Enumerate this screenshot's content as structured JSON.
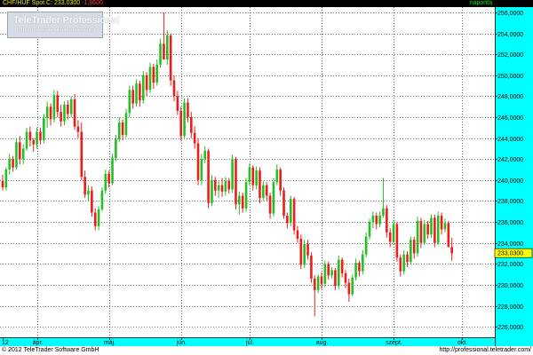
{
  "header": {
    "symbol": "CHF/HUF Spot",
    "close_label": "C:",
    "close_value": "233,0300",
    "change": "-1,8600",
    "frequency": "naponta"
  },
  "watermark": {
    "brand": "TeleTrader Professional",
    "url": "http://professional.teletrader.com/"
  },
  "footer": {
    "copyright": "© 2012 TeleTrader Software GmbH",
    "url": "http://professional.teletrader.com/"
  },
  "colors": {
    "up": "#22c022",
    "down": "#ee1c1c",
    "grid": "#000000",
    "axis_bg": "#00ffff",
    "plot_bg": "#ffffff",
    "header_bg": "#000000",
    "marker_bg": "#ffff00"
  },
  "chart_data": {
    "type": "candlestick",
    "y_ticks": [
      "226,0000",
      "228,0000",
      "230,0000",
      "232,0000",
      "234,0000",
      "236,0000",
      "238,0000",
      "240,0000",
      "242,0000",
      "244,0000",
      "246,0000",
      "248,0000",
      "250,0000",
      "252,0000",
      "254,0000",
      "256,0000"
    ],
    "ylim": [
      225,
      256.5
    ],
    "x_labels": [
      {
        "label": "12",
        "index": 0
      },
      {
        "label": "ápr.",
        "index": 10
      },
      {
        "label": "máj.",
        "index": 31
      },
      {
        "label": "jún.",
        "index": 52
      },
      {
        "label": "júl.",
        "index": 72
      },
      {
        "label": "aug.",
        "index": 93
      },
      {
        "label": "szept.",
        "index": 114
      },
      {
        "label": "okt.",
        "index": 134
      }
    ],
    "current_value_marker": "233,0300",
    "series": [
      {
        "name": "CHF/HUF Spot",
        "candles": [
          [
            239.9,
            240.5,
            239.0,
            239.3
          ],
          [
            239.3,
            241.2,
            239.0,
            241.0
          ],
          [
            241.0,
            242.5,
            240.5,
            242.0
          ],
          [
            242.0,
            242.3,
            240.8,
            241.2
          ],
          [
            241.2,
            244.0,
            241.0,
            243.6
          ],
          [
            243.6,
            244.2,
            241.5,
            242.0
          ],
          [
            242.0,
            243.4,
            241.5,
            243.0
          ],
          [
            243.0,
            245.0,
            242.8,
            244.6
          ],
          [
            244.6,
            245.1,
            243.2,
            243.8
          ],
          [
            243.8,
            244.0,
            242.7,
            243.4
          ],
          [
            243.4,
            245.0,
            243.0,
            244.6
          ],
          [
            244.6,
            245.0,
            243.4,
            243.8
          ],
          [
            243.8,
            246.3,
            243.5,
            245.9
          ],
          [
            245.9,
            247.5,
            245.0,
            247.0
          ],
          [
            247.0,
            247.3,
            245.2,
            245.8
          ],
          [
            245.8,
            248.6,
            245.5,
            248.1
          ],
          [
            248.1,
            248.5,
            246.0,
            246.5
          ],
          [
            246.5,
            247.2,
            245.1,
            245.6
          ],
          [
            245.6,
            247.5,
            245.2,
            247.2
          ],
          [
            247.2,
            247.6,
            245.8,
            246.3
          ],
          [
            246.3,
            248.0,
            246.0,
            247.7
          ],
          [
            247.7,
            248.2,
            244.8,
            245.1
          ],
          [
            245.1,
            245.7,
            244.0,
            244.6
          ],
          [
            244.6,
            245.5,
            240.0,
            240.3
          ],
          [
            240.3,
            240.9,
            238.3,
            238.6
          ],
          [
            238.6,
            239.5,
            238.0,
            239.0
          ],
          [
            239.0,
            239.4,
            236.5,
            236.9
          ],
          [
            236.9,
            237.3,
            235.2,
            235.6
          ],
          [
            235.6,
            237.5,
            235.2,
            237.2
          ],
          [
            237.2,
            239.3,
            237.0,
            239.0
          ],
          [
            239.0,
            241.0,
            238.7,
            240.6
          ],
          [
            240.6,
            240.9,
            239.3,
            239.7
          ],
          [
            239.7,
            242.5,
            239.5,
            242.1
          ],
          [
            242.1,
            244.3,
            241.8,
            243.9
          ],
          [
            243.9,
            246.0,
            243.6,
            245.5
          ],
          [
            245.5,
            245.8,
            243.8,
            244.3
          ],
          [
            244.3,
            246.8,
            244.0,
            246.4
          ],
          [
            246.4,
            249.0,
            246.0,
            248.6
          ],
          [
            248.6,
            249.0,
            246.8,
            247.3
          ],
          [
            247.3,
            249.6,
            247.0,
            249.2
          ],
          [
            249.2,
            249.5,
            247.0,
            247.6
          ],
          [
            247.6,
            250.4,
            247.3,
            250.0
          ],
          [
            250.0,
            250.3,
            248.0,
            248.6
          ],
          [
            248.6,
            251.2,
            248.3,
            250.8
          ],
          [
            250.8,
            251.1,
            248.7,
            249.3
          ],
          [
            249.3,
            251.5,
            249.0,
            251.0
          ],
          [
            251.0,
            253.5,
            250.7,
            253.0
          ],
          [
            253.0,
            256.0,
            252.5,
            251.5
          ],
          [
            251.5,
            254.3,
            251.0,
            253.8
          ],
          [
            253.8,
            254.0,
            249.0,
            249.5
          ],
          [
            249.5,
            250.0,
            247.5,
            248.0
          ],
          [
            248.0,
            248.5,
            246.2,
            246.6
          ],
          [
            246.6,
            247.0,
            243.8,
            244.2
          ],
          [
            244.2,
            247.8,
            244.0,
            247.4
          ],
          [
            247.4,
            247.8,
            245.5,
            246.0
          ],
          [
            246.0,
            246.5,
            244.0,
            244.5
          ],
          [
            244.5,
            245.1,
            243.0,
            243.5
          ],
          [
            243.5,
            244.0,
            239.5,
            240.0
          ],
          [
            240.0,
            242.5,
            239.5,
            242.0
          ],
          [
            242.0,
            243.2,
            241.6,
            242.8
          ],
          [
            242.8,
            243.0,
            237.3,
            237.8
          ],
          [
            237.8,
            240.5,
            237.5,
            240.0
          ],
          [
            240.0,
            240.3,
            238.5,
            239.0
          ],
          [
            239.0,
            239.9,
            238.3,
            239.5
          ],
          [
            239.5,
            240.2,
            238.4,
            238.9
          ],
          [
            238.9,
            240.3,
            238.5,
            239.9
          ],
          [
            239.9,
            240.2,
            238.7,
            239.1
          ],
          [
            239.1,
            242.4,
            238.8,
            242.0
          ],
          [
            242.0,
            242.2,
            237.2,
            237.7
          ],
          [
            237.7,
            238.9,
            236.7,
            238.5
          ],
          [
            238.5,
            238.8,
            236.9,
            237.3
          ],
          [
            237.3,
            240.2,
            237.0,
            239.8
          ],
          [
            239.8,
            241.6,
            239.5,
            241.2
          ],
          [
            241.2,
            241.4,
            239.0,
            239.5
          ],
          [
            239.5,
            241.3,
            239.1,
            240.9
          ],
          [
            240.9,
            241.2,
            237.8,
            238.3
          ],
          [
            238.3,
            239.9,
            238.0,
            239.5
          ],
          [
            239.5,
            239.8,
            238.0,
            238.5
          ],
          [
            238.5,
            238.8,
            236.3,
            236.8
          ],
          [
            236.8,
            240.2,
            236.5,
            239.8
          ],
          [
            239.8,
            241.5,
            239.5,
            241.0
          ],
          [
            241.0,
            241.2,
            238.5,
            239.0
          ],
          [
            239.0,
            239.3,
            236.3,
            236.6
          ],
          [
            236.6,
            236.9,
            235.4,
            235.9
          ],
          [
            235.9,
            238.5,
            235.6,
            238.2
          ],
          [
            238.2,
            238.4,
            234.8,
            235.2
          ],
          [
            235.2,
            235.6,
            234.0,
            234.4
          ],
          [
            234.4,
            234.8,
            231.5,
            231.9
          ],
          [
            231.9,
            234.3,
            231.6,
            233.9
          ],
          [
            233.9,
            234.3,
            232.4,
            232.8
          ],
          [
            232.8,
            233.1,
            230.2,
            230.6
          ],
          [
            230.6,
            230.9,
            227.0,
            229.5
          ],
          [
            229.5,
            231.0,
            229.2,
            230.8
          ],
          [
            230.8,
            231.2,
            229.6,
            230.1
          ],
          [
            230.1,
            232.3,
            229.8,
            232.0
          ],
          [
            232.0,
            232.2,
            230.5,
            230.9
          ],
          [
            230.9,
            231.7,
            230.6,
            231.4
          ],
          [
            231.4,
            231.6,
            229.5,
            229.9
          ],
          [
            229.9,
            232.8,
            229.6,
            232.4
          ],
          [
            232.4,
            232.6,
            230.7,
            231.1
          ],
          [
            231.1,
            231.4,
            229.7,
            230.2
          ],
          [
            230.2,
            230.6,
            228.4,
            229.1
          ],
          [
            229.1,
            231.0,
            228.9,
            230.7
          ],
          [
            230.7,
            232.5,
            230.4,
            232.1
          ],
          [
            232.1,
            232.3,
            230.8,
            231.3
          ],
          [
            231.3,
            233.3,
            231.0,
            232.9
          ],
          [
            232.9,
            235.0,
            232.6,
            234.6
          ],
          [
            234.6,
            236.3,
            234.3,
            236.0
          ],
          [
            236.0,
            237.0,
            235.4,
            236.6
          ],
          [
            236.6,
            236.9,
            235.3,
            235.8
          ],
          [
            235.8,
            237.0,
            235.5,
            236.6
          ],
          [
            236.6,
            240.2,
            236.4,
            237.3
          ],
          [
            237.3,
            237.6,
            234.5,
            235.0
          ],
          [
            235.0,
            235.4,
            233.6,
            234.1
          ],
          [
            234.1,
            236.2,
            233.8,
            235.8
          ],
          [
            235.8,
            236.0,
            232.2,
            232.6
          ],
          [
            232.6,
            232.9,
            230.8,
            231.3
          ],
          [
            231.3,
            233.3,
            231.0,
            232.9
          ],
          [
            232.9,
            233.2,
            231.7,
            232.2
          ],
          [
            232.2,
            234.6,
            231.9,
            234.3
          ],
          [
            234.3,
            234.6,
            232.5,
            233.0
          ],
          [
            233.0,
            236.5,
            232.7,
            236.1
          ],
          [
            236.1,
            236.4,
            233.5,
            234.0
          ],
          [
            234.0,
            236.2,
            233.8,
            235.8
          ],
          [
            235.8,
            236.1,
            234.4,
            234.8
          ],
          [
            234.8,
            236.7,
            234.5,
            236.4
          ],
          [
            236.4,
            236.7,
            233.6,
            234.0
          ],
          [
            234.0,
            237.0,
            233.8,
            236.6
          ],
          [
            236.6,
            236.9,
            234.8,
            235.3
          ],
          [
            235.3,
            236.3,
            235.0,
            235.9
          ],
          [
            235.9,
            236.1,
            233.9,
            233.6
          ],
          [
            233.6,
            234.5,
            232.3,
            233.0
          ]
        ]
      }
    ]
  }
}
